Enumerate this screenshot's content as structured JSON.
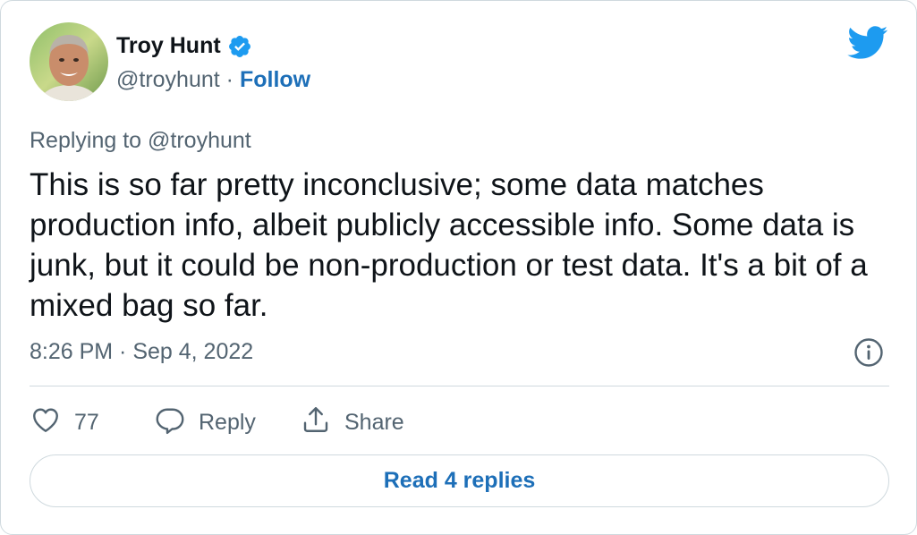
{
  "author": {
    "name": "Troy Hunt",
    "handle": "@troyhunt",
    "separator": "·",
    "follow_label": "Follow",
    "verified_icon": "verified-badge-icon",
    "verified_color": "#1d9bf0"
  },
  "brand": {
    "icon": "twitter-bird-icon",
    "color": "#1d9bf0"
  },
  "tweet": {
    "replying_to": "Replying to @troyhunt",
    "text": "This is so far pretty inconclusive; some data matches production info, albeit publicly accessible info. Some data is junk, but it could be non-production or test data. It's a bit of a mixed bag so far.",
    "timestamp": "8:26 PM · Sep 4, 2022"
  },
  "actions": {
    "like_count": "77",
    "reply_label": "Reply",
    "share_label": "Share"
  },
  "footer": {
    "read_replies_label": "Read 4 replies"
  },
  "colors": {
    "text_primary": "#0f1419",
    "text_secondary": "#536471",
    "link": "#1d6fb8",
    "border": "#cfd9de"
  }
}
